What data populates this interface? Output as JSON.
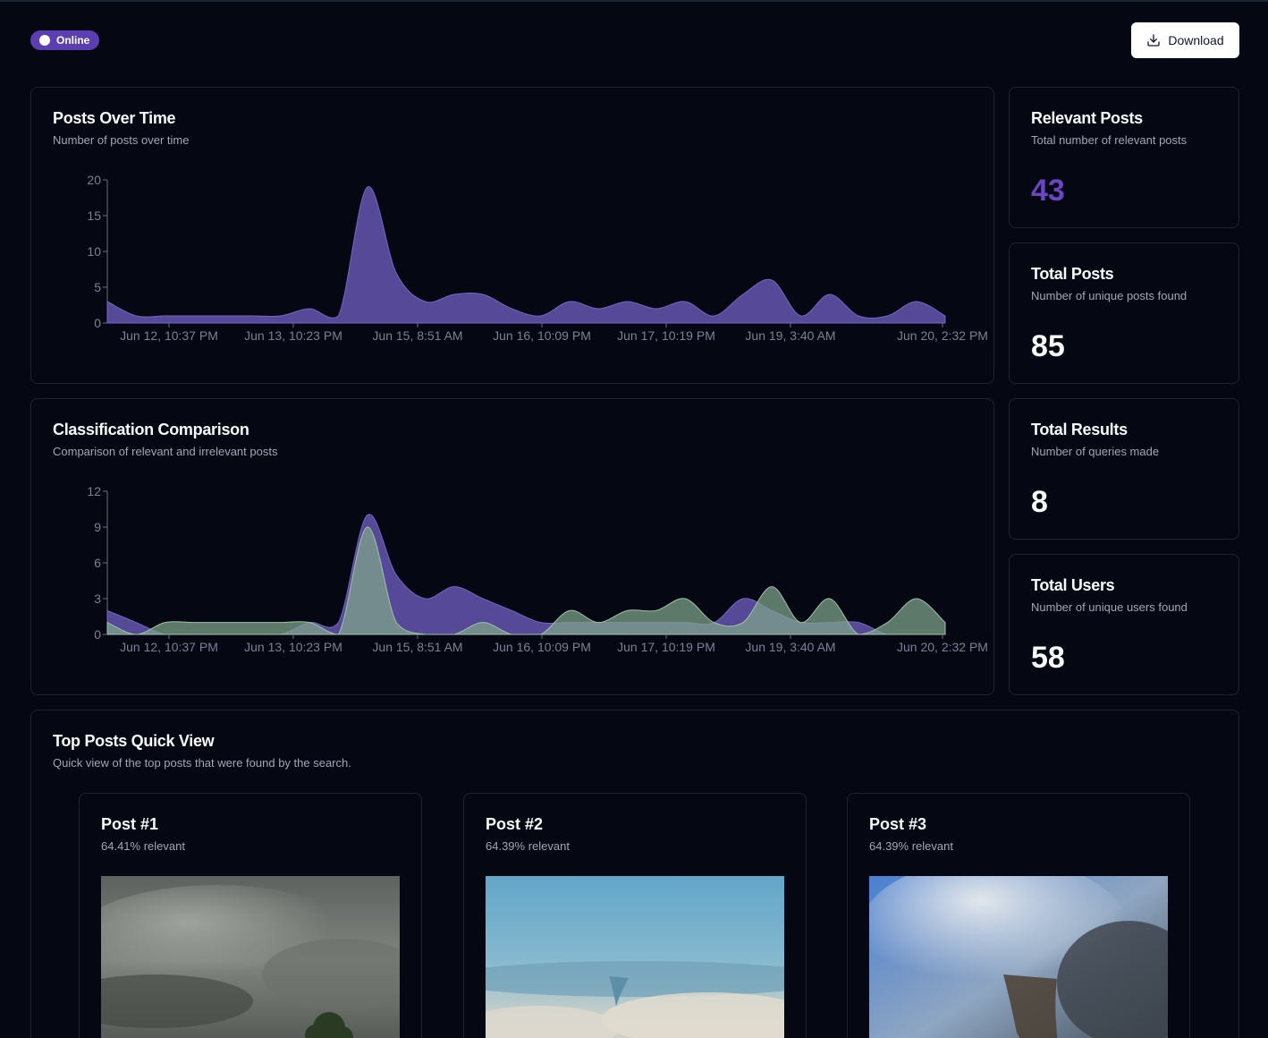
{
  "status": {
    "label": "Online"
  },
  "header": {
    "download_label": "Download"
  },
  "posts_over_time": {
    "title": "Posts Over Time",
    "subtitle": "Number of posts over time"
  },
  "classification": {
    "title": "Classification Comparison",
    "subtitle": "Comparison of relevant and irrelevant posts"
  },
  "stats": [
    {
      "title": "Relevant Posts",
      "subtitle": "Total number of relevant posts",
      "value": "43"
    },
    {
      "title": "Total Posts",
      "subtitle": "Number of unique posts found",
      "value": "85"
    },
    {
      "title": "Total Results",
      "subtitle": "Number of queries made",
      "value": "8"
    },
    {
      "title": "Total Users",
      "subtitle": "Number of unique users found",
      "value": "58"
    }
  ],
  "top_posts": {
    "title": "Top Posts Quick View",
    "subtitle": "Quick view of the top posts that were found by the search.",
    "items": [
      {
        "title": "Post #1",
        "relevance": "64.41% relevant"
      },
      {
        "title": "Post #2",
        "relevance": "64.39% relevant"
      },
      {
        "title": "Post #3",
        "relevance": "64.39% relevant"
      }
    ]
  },
  "colors": {
    "relevant": "#5b4d9e",
    "irrelevant": "#7fa68b",
    "accent": "#6b46c1"
  },
  "icons": {
    "download": "download-icon"
  },
  "chart_data": [
    {
      "type": "area",
      "title": "Posts Over Time",
      "subtitle": "Number of posts over time",
      "x_tick_labels": [
        "Jun 12, 10:37 PM",
        "Jun 13, 10:23 PM",
        "Jun 15, 8:51 AM",
        "Jun 16, 10:09 PM",
        "Jun 17, 10:19 PM",
        "Jun 19, 3:40 AM",
        "Jun 20, 2:32 PM"
      ],
      "y_ticks": [
        0,
        5,
        10,
        15,
        20
      ],
      "ylim": [
        0,
        20
      ],
      "series": [
        {
          "values": [
            3,
            1,
            1,
            1,
            1,
            1,
            1,
            2,
            1,
            19,
            7,
            3,
            4,
            4,
            2,
            1,
            3,
            2,
            3,
            2,
            3,
            1,
            4,
            6,
            1,
            4,
            1,
            1,
            3,
            1
          ]
        }
      ]
    },
    {
      "type": "area",
      "title": "Classification Comparison",
      "subtitle": "Comparison of relevant and irrelevant posts",
      "x_tick_labels": [
        "Jun 12, 10:37 PM",
        "Jun 13, 10:23 PM",
        "Jun 15, 8:51 AM",
        "Jun 16, 10:09 PM",
        "Jun 17, 10:19 PM",
        "Jun 19, 3:40 AM",
        "Jun 20, 2:32 PM"
      ],
      "y_ticks": [
        0,
        3,
        6,
        9,
        12
      ],
      "ylim": [
        0,
        12
      ],
      "series": [
        {
          "values": [
            2,
            1,
            0,
            0,
            0,
            0,
            0,
            1,
            1,
            10,
            5,
            3,
            4,
            3,
            2,
            1,
            1,
            1,
            1,
            1,
            1,
            1,
            3,
            2,
            1,
            1,
            1,
            0,
            0,
            0
          ]
        },
        {
          "values": [
            1,
            0,
            1,
            1,
            1,
            1,
            1,
            1,
            0,
            9,
            1,
            0,
            0,
            1,
            0,
            0,
            2,
            1,
            2,
            2,
            3,
            1,
            1,
            4,
            1,
            3,
            0,
            1,
            3,
            1
          ]
        }
      ]
    }
  ]
}
